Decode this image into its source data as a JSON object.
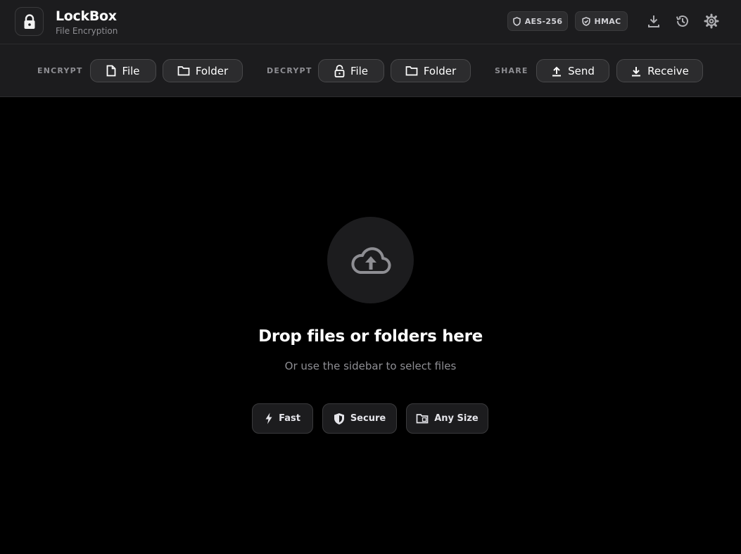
{
  "header": {
    "title": "LockBox",
    "subtitle": "File Encryption",
    "badges": [
      "AES-256",
      "HMAC"
    ],
    "icons": [
      "download-icon",
      "history-icon",
      "gear-icon"
    ]
  },
  "toolbar": {
    "encrypt": {
      "label": "ENCRYPT",
      "file": "File",
      "folder": "Folder"
    },
    "decrypt": {
      "label": "DECRYPT",
      "file": "File",
      "folder": "Folder"
    },
    "share": {
      "label": "SHARE",
      "send": "Send",
      "receive": "Receive"
    }
  },
  "dropzone": {
    "title": "Drop files or folders here",
    "subtitle": "Or use the sidebar to select files",
    "features": [
      "Fast",
      "Secure",
      "Any Size"
    ]
  },
  "colors": {
    "background": "#000000",
    "panel": "#1c1c1e",
    "button": "#2c2c2e",
    "muted": "#8e8e93"
  }
}
